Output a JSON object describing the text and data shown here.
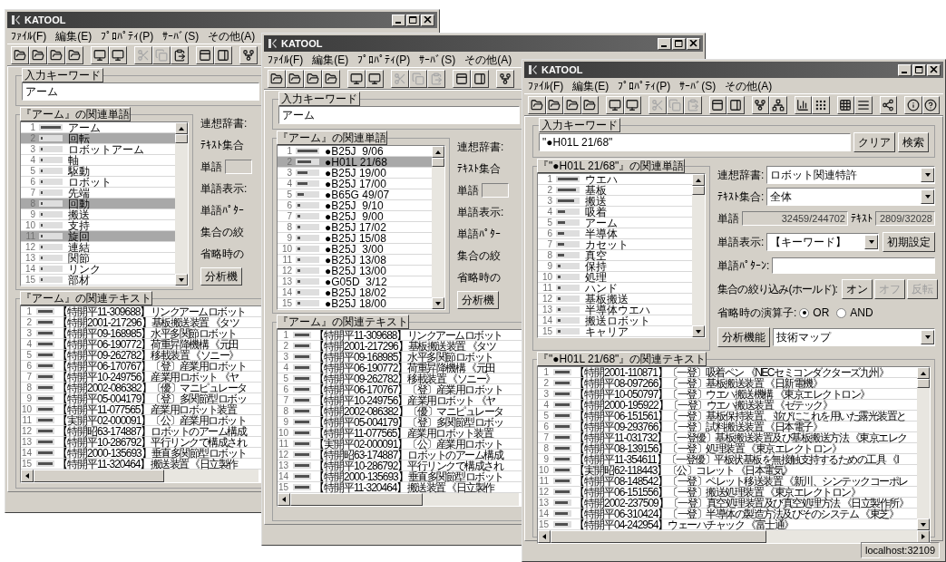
{
  "windows": [
    {
      "title": "KATOOL",
      "menu": [
        "ﾌｧｲﾙ(F)",
        "編集(E)",
        "ﾌﾟﾛﾊﾟﾃｨ(P)",
        "ｻｰﾊﾞ(S)",
        "その他(A)"
      ],
      "toolbar": [
        {
          "disabled": false
        },
        {
          "disabled": false
        },
        {
          "disabled": false
        },
        {
          "disabled": false
        },
        {
          "disabled": false
        },
        {
          "disabled": false
        },
        {
          "disabled": true
        },
        {
          "disabled": true
        },
        {
          "disabled": false
        },
        {
          "disabled": false
        },
        {
          "disabled": false
        },
        {
          "disabled": false
        }
      ],
      "keyword": {
        "label": "入力キーワード",
        "value": "アーム"
      },
      "words_label": "『アーム』の関連単語",
      "words": [
        {
          "n": "1",
          "text": "アーム",
          "level": 1,
          "selected": false
        },
        {
          "n": "2",
          "text": "回転",
          "level": 0.1,
          "selected": true
        },
        {
          "n": "3",
          "text": "ロボットアーム",
          "level": 0.1,
          "selected": false
        },
        {
          "n": "4",
          "text": "軸",
          "level": 0.1,
          "selected": false
        },
        {
          "n": "5",
          "text": "駆動",
          "level": 0.1,
          "selected": false
        },
        {
          "n": "6",
          "text": "ロボット",
          "level": 0.1,
          "selected": false
        },
        {
          "n": "7",
          "text": "先端",
          "level": 0.1,
          "selected": false
        },
        {
          "n": "8",
          "text": "回動",
          "level": 0.1,
          "selected": true
        },
        {
          "n": "9",
          "text": "搬送",
          "level": 0.1,
          "selected": false
        },
        {
          "n": "10",
          "text": "支持",
          "level": 0.1,
          "selected": false
        },
        {
          "n": "11",
          "text": "旋回",
          "level": 0.1,
          "selected": true
        },
        {
          "n": "12",
          "text": "連結",
          "level": 0.1,
          "selected": false
        },
        {
          "n": "13",
          "text": "関節",
          "level": 0.1,
          "selected": false
        },
        {
          "n": "14",
          "text": "リンク",
          "level": 0.1,
          "selected": false
        },
        {
          "n": "15",
          "text": "部材",
          "level": 0.1,
          "selected": false
        }
      ],
      "side": [
        {
          "kind": "label",
          "label": "連想辞書:"
        },
        {
          "kind": "label",
          "label": "ﾃｷｽﾄ集合"
        },
        {
          "kind": "label_box",
          "label": "単語"
        },
        {
          "kind": "label",
          "label": "単語表示:"
        },
        {
          "kind": "label",
          "label": "単語ﾊﾟﾀｰ"
        },
        {
          "kind": "label",
          "label": "集合の絞"
        },
        {
          "kind": "label",
          "label": "省略時の"
        },
        {
          "kind": "button",
          "label": "分析機"
        }
      ],
      "texts_label": "『アーム』の関連テキスト",
      "texts": [
        {
          "n": "1",
          "id": "【特開平11-309688】",
          "title": "リンクアームロボット",
          "level": 1
        },
        {
          "n": "2",
          "id": "【特開2001-217296】",
          "title": "基板搬送装置 《タツ",
          "level": 1
        },
        {
          "n": "3",
          "id": "【特開平09-168985】",
          "title": "水平多関節ロボット",
          "level": 1
        },
        {
          "n": "4",
          "id": "【特開平06-190772】",
          "title": "荷重昇降機構 《元田",
          "level": 1
        },
        {
          "n": "5",
          "id": "【特開平09-262782】",
          "title": "移載装置 《ソニー》",
          "level": 1
        },
        {
          "n": "6",
          "id": "【特開平06-170767】",
          "title": "〔登〕産業用ロボット",
          "level": 1
        },
        {
          "n": "7",
          "id": "【特開平10-249756】",
          "title": "産業用ロボット 《ヤ",
          "level": 1
        },
        {
          "n": "8",
          "id": "【特開2002-086382】",
          "title": "〔優〕マニピュレータ",
          "level": 1
        },
        {
          "n": "9",
          "id": "【特開平05-004179】",
          "title": "〔登〕多関節型ロボッ",
          "level": 1
        },
        {
          "n": "10",
          "id": "【特開平11-077565】",
          "title": "産業用ロボット装置",
          "level": 1
        },
        {
          "n": "11",
          "id": "【実開平02-000091】",
          "title": "〔公〕産業用ロボット",
          "level": 1
        },
        {
          "n": "12",
          "id": "【特開昭63-174887】",
          "title": "ロボットのアーム構成",
          "level": 1
        },
        {
          "n": "13",
          "id": "【特開平10-286792】",
          "title": "平行リンクで構成され",
          "level": 1
        },
        {
          "n": "14",
          "id": "【特開2000-135693】",
          "title": "垂直多関節型ロボット",
          "level": 1
        },
        {
          "n": "15",
          "id": "【特開平11-320464】",
          "title": "搬送装置 《日立製作",
          "level": 1
        }
      ]
    },
    {
      "title": "KATOOL",
      "menu": [
        "ﾌｧｲﾙ(F)",
        "編集(E)",
        "ﾌﾟﾛﾊﾟﾃｨ(P)",
        "ｻｰﾊﾞ(S)",
        "その他(A)"
      ],
      "toolbar": [
        {
          "disabled": false
        },
        {
          "disabled": false
        },
        {
          "disabled": false
        },
        {
          "disabled": false
        },
        {
          "disabled": false
        },
        {
          "disabled": false
        },
        {
          "disabled": true
        },
        {
          "disabled": true
        },
        {
          "disabled": true
        },
        {
          "disabled": false
        },
        {
          "disabled": false
        },
        {
          "disabled": false
        }
      ],
      "keyword": {
        "label": "入力キーワード",
        "value": "アーム"
      },
      "words_label": "『アーム』の関連単語",
      "words": [
        {
          "n": "1",
          "text": "●B25J  9/06",
          "level": 1,
          "selected": false
        },
        {
          "n": "2",
          "text": "●H01L 21/68",
          "level": 0.7,
          "selected": true
        },
        {
          "n": "3",
          "text": "●B25J 19/00",
          "level": 0.5,
          "selected": false
        },
        {
          "n": "4",
          "text": "●B25J 17/00",
          "level": 0.5,
          "selected": false
        },
        {
          "n": "5",
          "text": "●B65G 49/07",
          "level": 0.3,
          "selected": false
        },
        {
          "n": "6",
          "text": "●B25J  9/10",
          "level": 0.15,
          "selected": false
        },
        {
          "n": "7",
          "text": "●B25J  9/00",
          "level": 0.15,
          "selected": false
        },
        {
          "n": "8",
          "text": "●B25J 17/02",
          "level": 0.15,
          "selected": false
        },
        {
          "n": "9",
          "text": "●B25J 15/08",
          "level": 0.15,
          "selected": false
        },
        {
          "n": "10",
          "text": "●B25J  3/00",
          "level": 0.15,
          "selected": false
        },
        {
          "n": "11",
          "text": "●B25J 13/08",
          "level": 0.15,
          "selected": false
        },
        {
          "n": "12",
          "text": "●B25J 13/00",
          "level": 0.15,
          "selected": false
        },
        {
          "n": "13",
          "text": "●G05D  3/12",
          "level": 0.15,
          "selected": false
        },
        {
          "n": "14",
          "text": "●B25J 18/02",
          "level": 0.15,
          "selected": false
        },
        {
          "n": "15",
          "text": "●B25J 18/00",
          "level": 0.15,
          "selected": false
        }
      ],
      "side": [
        {
          "kind": "label",
          "label": "連想辞書:"
        },
        {
          "kind": "label",
          "label": "ﾃｷｽﾄ集合"
        },
        {
          "kind": "label_box",
          "label": "単語"
        },
        {
          "kind": "label",
          "label": "単語表示:"
        },
        {
          "kind": "label",
          "label": "単語ﾊﾟﾀｰ"
        },
        {
          "kind": "label",
          "label": "集合の絞"
        },
        {
          "kind": "label",
          "label": "省略時の"
        },
        {
          "kind": "button",
          "label": "分析機"
        }
      ],
      "texts_label": "『アーム』の関連テキスト",
      "texts": [
        {
          "n": "1",
          "id": "【特開平11-309688】",
          "title": "リンクアームロボット",
          "level": 1
        },
        {
          "n": "2",
          "id": "【特開2001-217296】",
          "title": "基板搬送装置 《タツ",
          "level": 1
        },
        {
          "n": "3",
          "id": "【特開平09-168985】",
          "title": "水平多関節ロボット",
          "level": 1
        },
        {
          "n": "4",
          "id": "【特開平06-190772】",
          "title": "荷重昇降機構 《元田",
          "level": 1
        },
        {
          "n": "5",
          "id": "【特開平09-262782】",
          "title": "移載装置 《ソニー》",
          "level": 1
        },
        {
          "n": "6",
          "id": "【特開平06-170767】",
          "title": "〔登〕産業用ロボット",
          "level": 1
        },
        {
          "n": "7",
          "id": "【特開平10-249756】",
          "title": "産業用ロボット 《ヤ",
          "level": 1
        },
        {
          "n": "8",
          "id": "【特開2002-086382】",
          "title": "〔優〕マニピュレータ",
          "level": 1
        },
        {
          "n": "9",
          "id": "【特開平05-004179】",
          "title": "〔登〕多関節型ロボッ",
          "level": 1
        },
        {
          "n": "10",
          "id": "【特開平11-077565】",
          "title": "産業用ロボット装置",
          "level": 1
        },
        {
          "n": "11",
          "id": "【実開平02-000091】",
          "title": "〔公〕産業用ロボット",
          "level": 1
        },
        {
          "n": "12",
          "id": "【特開昭63-174887】",
          "title": "ロボットのアーム構成",
          "level": 1
        },
        {
          "n": "13",
          "id": "【特開平10-286792】",
          "title": "平行リンクで構成され",
          "level": 1
        },
        {
          "n": "14",
          "id": "【特開2000-135693】",
          "title": "垂直多関節型ロボット",
          "level": 1
        },
        {
          "n": "15",
          "id": "【特開平11-320464】",
          "title": "搬送装置 《日立製作",
          "level": 1
        }
      ]
    },
    {
      "title": "KATOOL",
      "menu": [
        "ﾌｧｲﾙ(F)",
        "編集(E)",
        "ﾌﾟﾛﾊﾟﾃｨ(P)",
        "ｻｰﾊﾞ(S)",
        "その他(A)"
      ],
      "toolbar": [
        {
          "disabled": false
        },
        {
          "disabled": false
        },
        {
          "disabled": false
        },
        {
          "disabled": false
        },
        {
          "disabled": false
        },
        {
          "disabled": false
        },
        {
          "disabled": true
        },
        {
          "disabled": true
        },
        {
          "disabled": true
        },
        {
          "disabled": false
        },
        {
          "disabled": false
        },
        {
          "disabled": false
        },
        {
          "disabled": false
        },
        {
          "disabled": false
        },
        {
          "disabled": false
        },
        {
          "disabled": false
        },
        {
          "disabled": false
        },
        {
          "disabled": false
        },
        {
          "disabled": false
        },
        {
          "disabled": false
        }
      ],
      "keyword": {
        "label": "入力キーワード",
        "value": "\"●H01L 21/68\"",
        "buttons": [
          "クリア",
          "検索"
        ]
      },
      "words_label": "『\"●H01L 21/68\"』の関連単語",
      "words": [
        {
          "n": "1",
          "text": "ウエハ",
          "level": 1,
          "selected": false
        },
        {
          "n": "2",
          "text": "基板",
          "level": 0.9,
          "selected": false
        },
        {
          "n": "3",
          "text": "搬送",
          "level": 0.8,
          "selected": false
        },
        {
          "n": "4",
          "text": "吸着",
          "level": 0.35,
          "selected": false
        },
        {
          "n": "5",
          "text": "アーム",
          "level": 0.35,
          "selected": false
        },
        {
          "n": "6",
          "text": "半導体",
          "level": 0.3,
          "selected": false
        },
        {
          "n": "7",
          "text": "カセット",
          "level": 0.3,
          "selected": false
        },
        {
          "n": "8",
          "text": "真空",
          "level": 0.3,
          "selected": false
        },
        {
          "n": "9",
          "text": "保持",
          "level": 0.15,
          "selected": false
        },
        {
          "n": "10",
          "text": "処理",
          "level": 0.15,
          "selected": false
        },
        {
          "n": "11",
          "text": "ハンド",
          "level": 0.15,
          "selected": false
        },
        {
          "n": "12",
          "text": "基板搬送",
          "level": 0.15,
          "selected": false
        },
        {
          "n": "13",
          "text": "半導体ウエハ",
          "level": 0.15,
          "selected": false
        },
        {
          "n": "14",
          "text": "搬送ロボット",
          "level": 0.15,
          "selected": false
        },
        {
          "n": "15",
          "text": "キャリア",
          "level": 0.15,
          "selected": false
        }
      ],
      "side": [
        {
          "kind": "select",
          "label": "連想辞書:",
          "value": "ロボット関連特許"
        },
        {
          "kind": "select",
          "label": "ﾃｷｽﾄ集合:",
          "value": "全体"
        },
        {
          "kind": "counts",
          "label": "単語",
          "value": "32459/244702",
          "label_2": "ﾃｷｽﾄ",
          "value_2": "2809/32028"
        },
        {
          "kind": "select_button",
          "label": "単語表示:",
          "value": "【キーワード】",
          "button": "初期設定"
        },
        {
          "kind": "input",
          "label": "単語ﾊﾟﾀｰﾝ:"
        },
        {
          "kind": "buttons",
          "label": "集合の絞り込み(ホールド):",
          "buttons": [
            {
              "label": "オン",
              "disabled": false
            },
            {
              "label": "オフ",
              "disabled": true
            },
            {
              "label": "反転",
              "disabled": true
            }
          ]
        },
        {
          "kind": "radio",
          "label": "省略時の演算子:",
          "options": [
            {
              "label": "OR",
              "selected": true
            },
            {
              "label": "AND",
              "selected": false
            }
          ]
        },
        {
          "kind": "button_select",
          "label": "分析機能",
          "value": "技術マップ"
        }
      ],
      "texts_label": "『\"●H01L 21/68\"』の関連テキスト",
      "texts": [
        {
          "n": "1",
          "id": "【特開2001-110871】",
          "title": "〔一登〕吸着ペン 《NECセミコンダクターズ九州》",
          "level": 1
        },
        {
          "n": "2",
          "id": "【特開平08-097266】",
          "title": "〔一登〕基板搬送装置 《日新電機》",
          "level": 1
        },
        {
          "n": "3",
          "id": "【特開平10-050797】",
          "title": "〔一登〕ウエハ搬送機構 《東京エレクトロン》",
          "level": 1
        },
        {
          "n": "4",
          "id": "【特開2000-195922】",
          "title": "〔一登〕ウエハ搬送装置 《ゼテック》",
          "level": 1
        },
        {
          "n": "5",
          "id": "【特開平06-151561】",
          "title": "〔一登〕基板保持装置、並びにこれを用いた露光装置と",
          "level": 1
        },
        {
          "n": "6",
          "id": "【特開平09-293766】",
          "title": "〔一登〕試料搬送装置 《日本電子》",
          "level": 1
        },
        {
          "n": "7",
          "id": "【特開平11-031732】",
          "title": "〔一登優〕基板搬送装置及び基板搬送方法 《東京エレク",
          "level": 1
        },
        {
          "n": "8",
          "id": "【特開平08-139156】",
          "title": "〔一登〕処理装置 《東京エレクトロン》",
          "level": 1
        },
        {
          "n": "9",
          "id": "【特開平11-354611】",
          "title": "〔一登優〕平板状基板を無接触支持するための工具 《I",
          "level": 1
        },
        {
          "n": "10",
          "id": "【実開昭62-118443】",
          "title": "〔公〕コレット 《日本電気》",
          "level": 1
        },
        {
          "n": "11",
          "id": "【特開平08-148542】",
          "title": "〔一登〕ペレット移送装置 《新川、シンテックコーポレ",
          "level": 1
        },
        {
          "n": "12",
          "id": "【特開平06-151556】",
          "title": "〔一登〕搬送処理装置 《東京エレクトロン》",
          "level": 1
        },
        {
          "n": "13",
          "id": "【特開2002-237509】",
          "title": "〔一登〕真空処理装置及び真空処理方法 《日立製作所》",
          "level": 0.85
        },
        {
          "n": "14",
          "id": "【特開平06-310424】",
          "title": "〔一登〕半導体の製造方法及びそのシステム 《東芝》",
          "level": 0.85
        },
        {
          "n": "15",
          "id": "【特開平04-242954】",
          "title": "ウェーハチャック 《富士通》",
          "level": 0.85
        }
      ],
      "status": "localhost:32109"
    }
  ]
}
